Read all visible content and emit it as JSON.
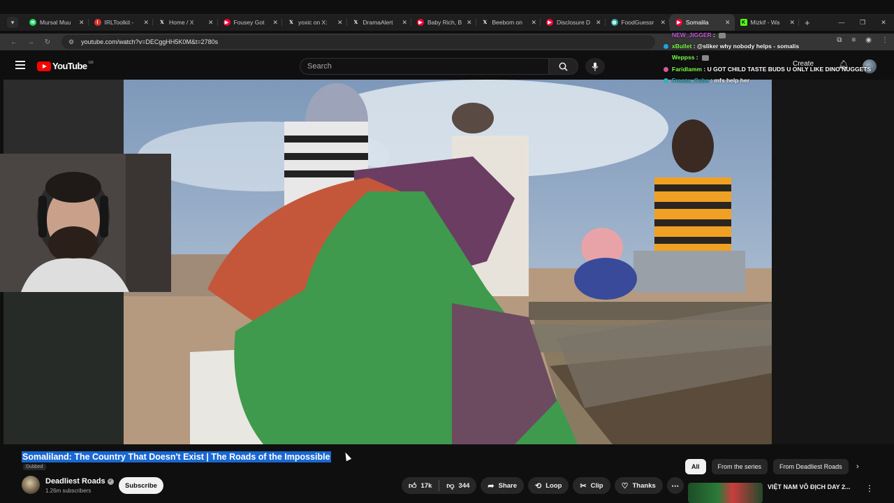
{
  "browser": {
    "tab_list_icon": "chevron-down-icon",
    "tabs": [
      {
        "title": "Mursal Muu",
        "icon": "spotify-icon",
        "icon_color": "#1ed760",
        "active": false
      },
      {
        "title": "IRLToolkit -",
        "icon": "irl-icon",
        "icon_color": "#e0312b",
        "active": false
      },
      {
        "title": "Home / X",
        "icon": "x-icon",
        "icon_color": "#1f1f1f",
        "active": false
      },
      {
        "title": "Fousey Got",
        "icon": "youtube-icon",
        "icon_color": "#ff0033",
        "active": false
      },
      {
        "title": "yoxic on X:",
        "icon": "x-icon",
        "icon_color": "#1f1f1f",
        "active": false
      },
      {
        "title": "DramaAlert",
        "icon": "x-icon",
        "icon_color": "#1f1f1f",
        "active": false
      },
      {
        "title": "Baby Rich, B",
        "icon": "youtube-icon",
        "icon_color": "#ff0033",
        "active": false
      },
      {
        "title": "Beebom on",
        "icon": "x-icon",
        "icon_color": "#1f1f1f",
        "active": false
      },
      {
        "title": "Disclosure D",
        "icon": "youtube-icon",
        "icon_color": "#ff0033",
        "active": false
      },
      {
        "title": "FoodGuessr",
        "icon": "globe-icon",
        "icon_color": "#2fa7a0",
        "active": false
      },
      {
        "title": "Somalila",
        "icon": "youtube-icon",
        "icon_color": "#ff0033",
        "active": true
      },
      {
        "title": "Mizkif - Wa",
        "icon": "kick-icon",
        "icon_color": "#53fc18",
        "active": false
      }
    ],
    "close_glyph": "✕",
    "new_tab_glyph": "+",
    "url": "youtube.com/watch?v=DECggHH5K0M&t=2780s",
    "window_controls": [
      "—",
      "❐",
      "✕"
    ]
  },
  "youtube": {
    "logo_text": "YouTube",
    "logo_region": "GB",
    "search_placeholder": "Search",
    "create_label": "Create",
    "video": {
      "title": "Somaliland: The Country That Doesn't Exist | The Roads of the Impossible",
      "dubbed_label": "Dubbed"
    },
    "channel": {
      "name": "Deadliest Roads",
      "subscribers": "1.26m subscribers",
      "subscribe_label": "Subscribe"
    },
    "actions": {
      "likes": "17k",
      "dislikes": "344",
      "share": "Share",
      "loop": "Loop",
      "clip": "Clip",
      "thanks": "Thanks"
    },
    "chips": [
      "All",
      "From the series",
      "From Deadliest Roads"
    ],
    "recommendation": {
      "title": "VIỆT NAM VÔ ĐỊCH DAY 2..."
    }
  },
  "chat": [
    {
      "user": "NEW_JIGGER",
      "message": "",
      "color": "#c45bd9",
      "badge_color": "",
      "emote": true
    },
    {
      "user": "xBullet",
      "message": "@sliker why nobody helps - somalis",
      "color": "#7cff4a",
      "badge_color": "#19a7e0",
      "emote": false
    },
    {
      "user": "Weppss",
      "message": "",
      "color": "#7cff4a",
      "badge_color": "",
      "emote": true
    },
    {
      "user": "Faridlamm",
      "message": "U GOT CHILD TASTE BUDS U ONLY LIKE DINO NUGGETS",
      "color": "#7cff4a",
      "badge_color": "#e0569a",
      "emote": false
    },
    {
      "user": "Freeze_Cube",
      "message": "mfs help her",
      "color": "#2fb4b4",
      "badge_color": "#2fb4b4",
      "emote": false
    }
  ]
}
